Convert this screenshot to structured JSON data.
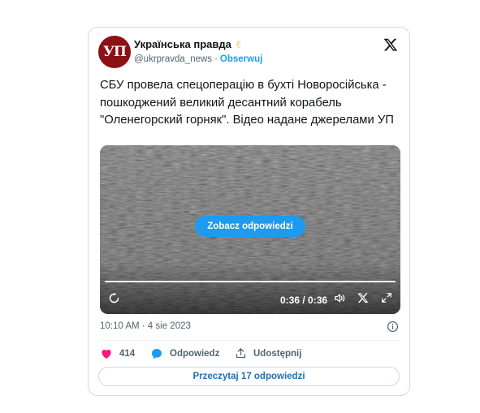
{
  "account": {
    "avatar_text": "УП",
    "name": "Українська правда",
    "badge_emoji": "✌",
    "handle": "@ukrpravda_news",
    "separator": "·",
    "follow_label": "Obserwuj"
  },
  "tweet": {
    "text": "СБУ провела спецоперацію в бухті Новоросійська - пошкоджений великий десантний корабель \"Оленегорский горняк\". Відео надане джерелами УП",
    "timestamp": "10:10 AM · 4 sie 2023"
  },
  "video": {
    "overlay_button": "Zobacz odpowiedzi",
    "time": "0:36 / 0:36",
    "progress": 1.0
  },
  "actions": {
    "likes": "414",
    "reply_label": "Odpowiedz",
    "share_label": "Udostępnij"
  },
  "read_replies_label": "Przeczytaj 17 odpowiedzi",
  "colors": {
    "accent": "#1d9bf0",
    "like": "#f91880",
    "avatar_bg": "#8b1114"
  }
}
